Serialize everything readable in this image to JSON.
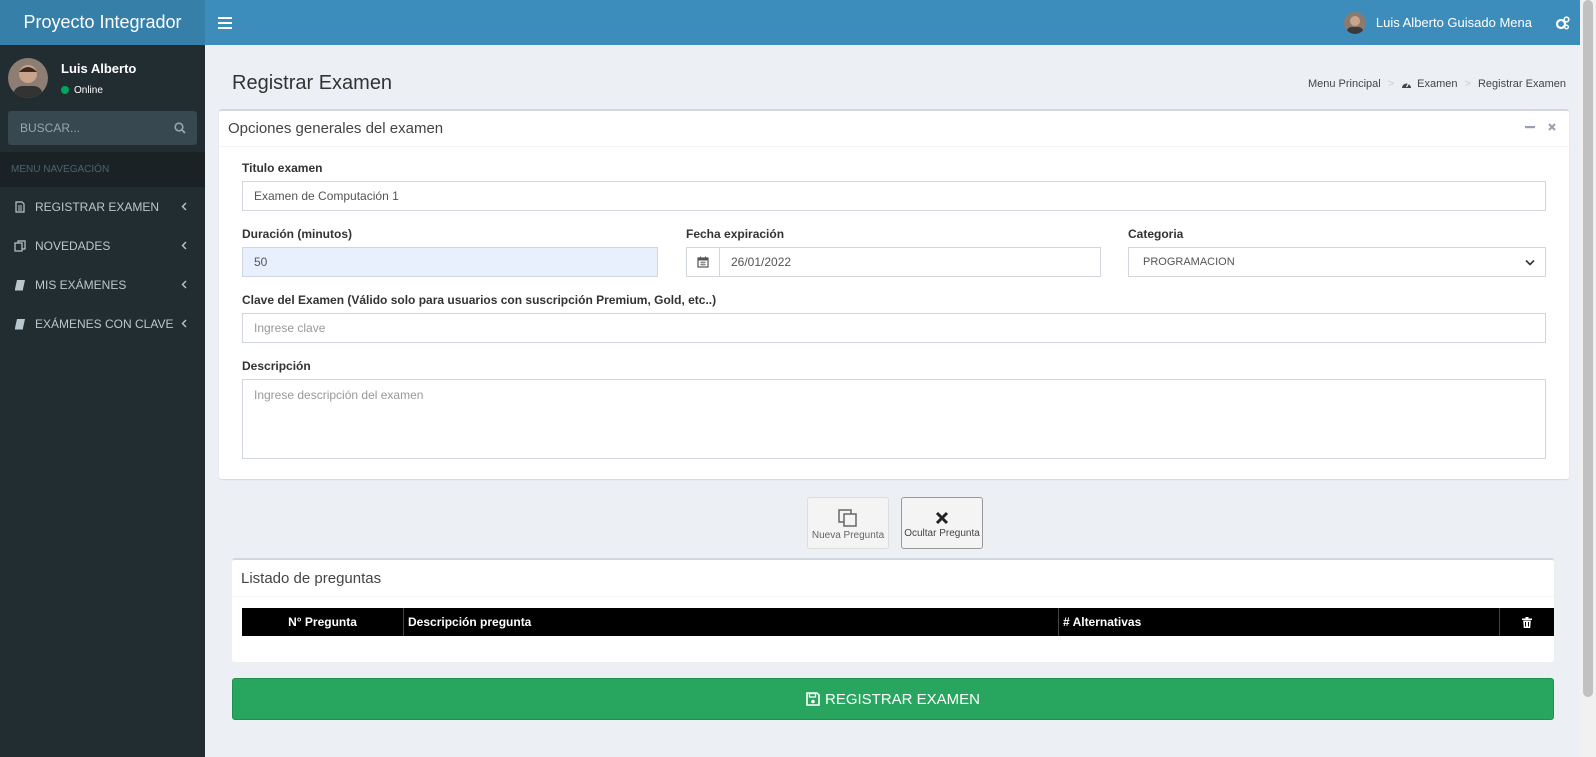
{
  "header": {
    "brand": "Proyecto Integrador",
    "user_name": "Luis Alberto Guisado Mena"
  },
  "sidebar": {
    "user_name": "Luis Alberto",
    "status": "Online",
    "search_placeholder": "BUSCAR...",
    "menu_header": "MENU NAVEGACIÓN",
    "items": [
      {
        "label": "REGISTRAR EXAMEN",
        "icon": "document-icon"
      },
      {
        "label": "NOVEDADES",
        "icon": "copy-icon"
      },
      {
        "label": "MIS EXÁMENES",
        "icon": "book-icon"
      },
      {
        "label": "EXÁMENES CON CLAVE",
        "icon": "book-icon"
      }
    ]
  },
  "page": {
    "title": "Registrar Examen",
    "breadcrumb": [
      "Menu Principal",
      "Examen",
      "Registrar Examen"
    ]
  },
  "form": {
    "box_title": "Opciones generales del examen",
    "titulo_label": "Titulo examen",
    "titulo_value": "Examen de Computación 1",
    "duracion_label": "Duración (minutos)",
    "duracion_value": "50",
    "fecha_label": "Fecha expiración",
    "fecha_value": "26/01/2022",
    "categoria_label": "Categoria",
    "categoria_value": "PROGRAMACION",
    "clave_label": "Clave del Examen (Válido solo para usuarios con suscripción Premium, Gold, etc..)",
    "clave_placeholder": "Ingrese clave",
    "descripcion_label": "Descripción",
    "descripcion_placeholder": "Ingrese descripción del examen"
  },
  "actions": {
    "nueva": "Nueva Pregunta",
    "ocultar": "Ocultar Pregunta"
  },
  "questions": {
    "title": "Listado de preguntas",
    "columns": [
      "N° Pregunta",
      "Descripción pregunta",
      "# Alternativas"
    ]
  },
  "submit_label": "REGISTRAR EXAMEN",
  "colors": {
    "header": "#3c8dbc",
    "sidebar": "#222d32",
    "submit": "#28a55f"
  }
}
